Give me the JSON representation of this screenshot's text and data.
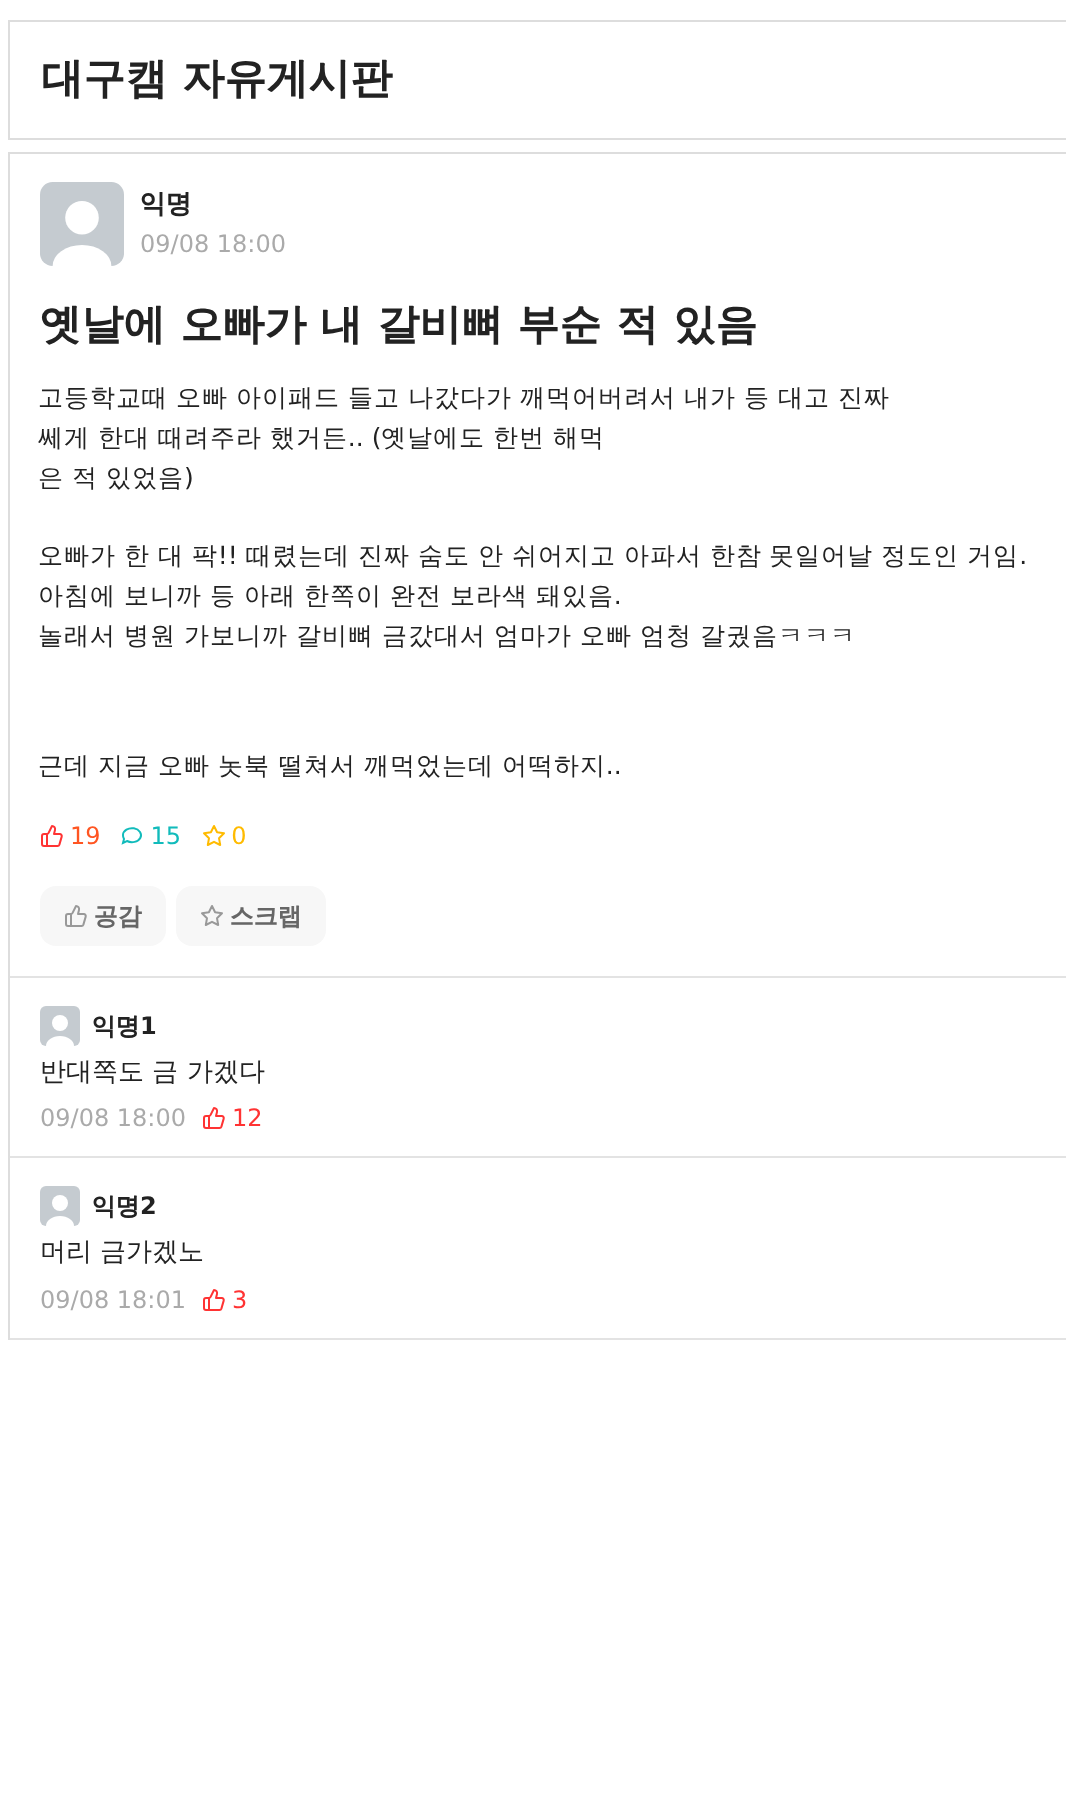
{
  "board": {
    "title": "대구캠 자유게시판"
  },
  "post": {
    "author": "익명",
    "time": "09/08 18:00",
    "title": "옛날에 오빠가 내 갈비뼈 부순 적 있음",
    "paragraphs": [
      [
        "고등학교때 오빠 아이패드 들고 나갔다가 깨먹어버려서 내가 등 대고 진짜",
        "쎄게 한대 때려주라 했거든.. (옛날에도 한번 해먹",
        "은 적 있었음)"
      ],
      [
        "오빠가 한 대 팍!! 때렸는데 진짜 숨도 안 쉬어지고 아파서 한참 못일어날 정도인 거임.",
        "아침에 보니까 등 아래 한쪽이 완전 보라색 돼있음.",
        "놀래서 병원 가보니까 갈비뼈 금갔대서 엄마가 오빠 엄청 갈궜음ㅋㅋㅋ"
      ],
      [
        "근데 지금 오빠 놋북 떨쳐서 깨먹었는데 어떡하지.."
      ]
    ],
    "stats": {
      "likes": "19",
      "comments": "15",
      "scraps": "0"
    },
    "actions": [
      {
        "kind": "like",
        "label": "공감"
      },
      {
        "kind": "scrap",
        "label": "스크랩"
      }
    ]
  },
  "comments": [
    {
      "author": "익명1",
      "text": "반대쪽도 금 가겠다",
      "time": "09/08 18:00",
      "likes": "12"
    },
    {
      "author": "익명2",
      "text": "머리 금가겠노",
      "time": "09/08 18:01",
      "likes": "3"
    }
  ]
}
